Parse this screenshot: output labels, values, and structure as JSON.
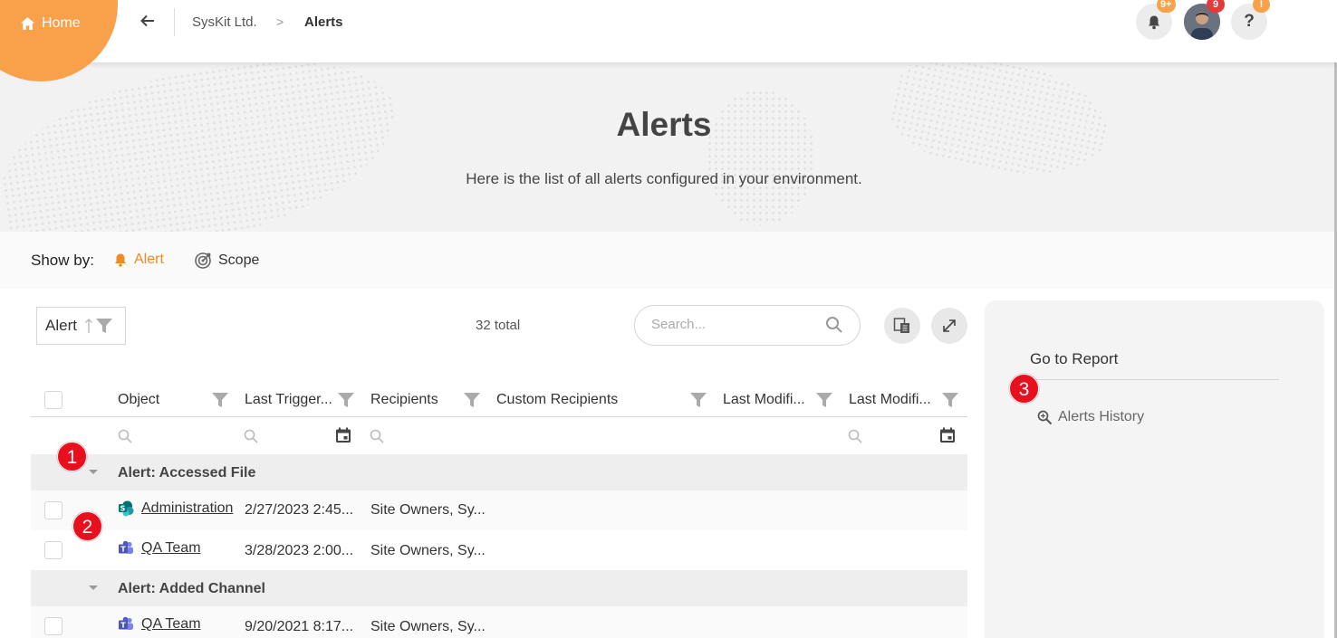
{
  "topbar": {
    "home_label": "Home",
    "breadcrumb": [
      "SysKit Ltd.",
      ">",
      "Alerts"
    ],
    "notifications_badge": "9+",
    "avatar_badge": "9",
    "help_badge": "!",
    "help_glyph": "?"
  },
  "hero": {
    "title": "Alerts",
    "subtitle": "Here is the list of all alerts configured in your environment."
  },
  "showby": {
    "label": "Show by:",
    "options": [
      {
        "label": "Alert",
        "icon": "bell-icon",
        "active": true
      },
      {
        "label": "Scope",
        "icon": "target-icon",
        "active": false
      }
    ]
  },
  "toolbar": {
    "sort_label": "Alert",
    "total": "32 total",
    "search_placeholder": "Search..."
  },
  "table": {
    "columns": [
      "Object",
      "Last Trigger...",
      "Recipients",
      "Custom Recipients",
      "Last Modifi...",
      "Last Modifi..."
    ],
    "groups": [
      {
        "title": "Alert: Accessed File",
        "rows": [
          {
            "object": "Administration",
            "icon": "sharepoint-icon",
            "last_triggered": "2/27/2023 2:45...",
            "recipients": "Site Owners, Sy..."
          },
          {
            "object": "QA Team",
            "icon": "teams-icon",
            "last_triggered": "3/28/2023 2:00...",
            "recipients": "Site Owners, Sy..."
          }
        ]
      },
      {
        "title": "Alert: Added Channel",
        "rows": [
          {
            "object": "QA Team",
            "icon": "teams-icon",
            "last_triggered": "9/20/2021 8:17...",
            "recipients": "Site Owners, Sy..."
          }
        ]
      }
    ]
  },
  "panel": {
    "title": "Go to Report",
    "link": "Alerts History"
  },
  "markers": [
    "1",
    "2",
    "3"
  ],
  "colors": {
    "accent": "#f9a14a",
    "badge_red": "#e53a3a",
    "marker_red": "#e8101f"
  }
}
